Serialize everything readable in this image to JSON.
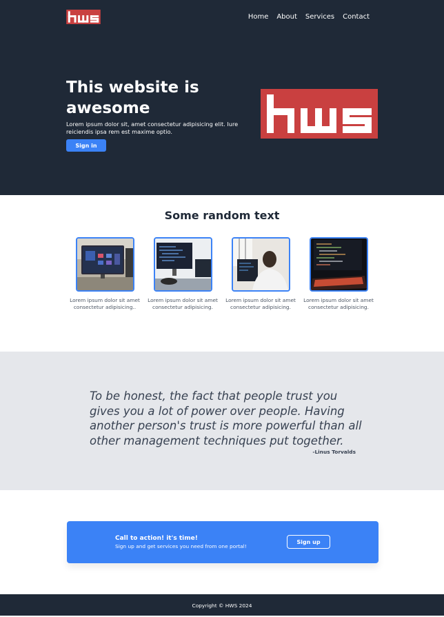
{
  "header": {
    "logo_text": "hws",
    "nav": [
      "Home",
      "About",
      "Services",
      "Contact"
    ]
  },
  "hero": {
    "title": "This website is awesome",
    "text": "Lorem ipsum dolor sit, amet consectetur adipisicing elit. Iure reiciendis ipsa rem est maxime optio.",
    "button_label": "Sign in",
    "logo_text": "hws"
  },
  "features": {
    "title": "Some random text",
    "cards": [
      {
        "text": "Lorem ipsum dolor sit amet consectetur adipisicing..",
        "image": "monitor-dashboard"
      },
      {
        "text": "Lorem ipsum dolor sit amet consectetur adipisicing.",
        "image": "dual-monitor-code"
      },
      {
        "text": "Lorem ipsum dolor sit amet consectetur adipisicing.",
        "image": "person-at-computer"
      },
      {
        "text": "Lorem ipsum dolor sit amet consectetur adipisicing.",
        "image": "code-screen-keyboard"
      }
    ]
  },
  "quote": {
    "text": "To be honest, the fact that people trust you gives you a lot of power over people. Having another person's trust is more powerful than all other management techniques put together.",
    "author": "-Linus Torvalds"
  },
  "cta": {
    "title": "Call to action! it's time!",
    "subtitle": "Sign up and get services you need from one portal!",
    "button_label": "Sign up"
  },
  "footer": {
    "text": "Copyright © HWS 2024"
  },
  "colors": {
    "dark": "#1f2937",
    "accent": "#3b82f6",
    "logo_red": "#c94040",
    "band": "#e5e7eb"
  }
}
